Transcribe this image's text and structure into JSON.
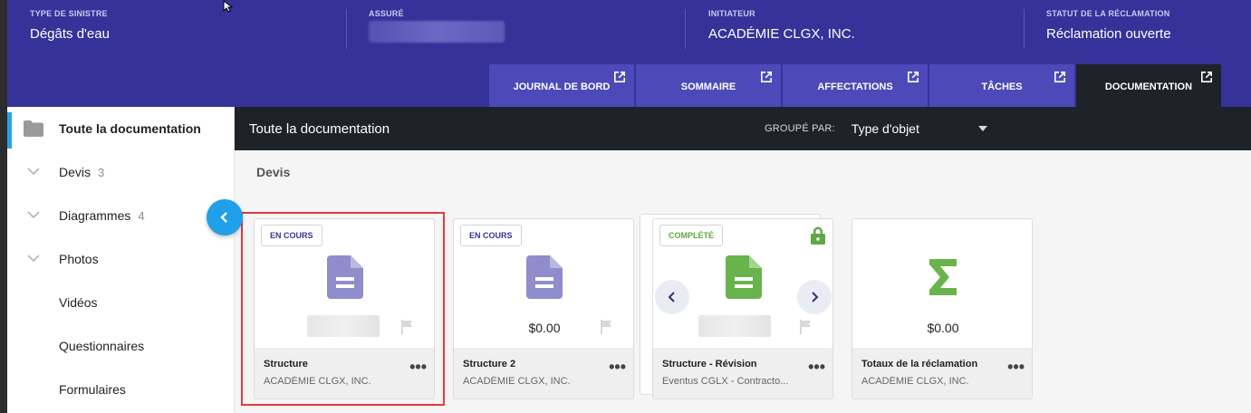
{
  "header": {
    "fields": [
      {
        "label": "TYPE DE SINISTRE",
        "value": "Dégâts d'eau"
      },
      {
        "label": "ASSURÉ",
        "value": ""
      },
      {
        "label": "INITIATEUR",
        "value": "ACADÉMIE CLGX, INC."
      },
      {
        "label": "STATUT DE LA RÉCLAMATION",
        "value": "Réclamation ouverte"
      }
    ],
    "tabs": [
      {
        "label": "JOURNAL DE BORD"
      },
      {
        "label": "SOMMAIRE"
      },
      {
        "label": "AFFECTATIONS"
      },
      {
        "label": "TÂCHES"
      },
      {
        "label": "DOCUMENTATION",
        "active": true
      }
    ]
  },
  "sidebar": {
    "items": [
      {
        "label": "Toute la documentation",
        "count": ""
      },
      {
        "label": "Devis",
        "count": "3"
      },
      {
        "label": "Diagrammes",
        "count": "4"
      },
      {
        "label": "Photos",
        "count": ""
      },
      {
        "label": "Vidéos",
        "count": ""
      },
      {
        "label": "Questionnaires",
        "count": ""
      },
      {
        "label": "Formulaires",
        "count": ""
      }
    ]
  },
  "toolbar": {
    "title": "Toute la documentation",
    "group_label": "GROUPÉ PAR:",
    "group_value": "Type d'objet"
  },
  "section": {
    "title": "Devis"
  },
  "cards": [
    {
      "badge": "EN COURS",
      "amount": "",
      "name": "Structure",
      "sub": "ACADÉMIE CLGX, INC."
    },
    {
      "badge": "EN COURS",
      "amount": "$0.00",
      "name": "Structure 2",
      "sub": "ACADÉMIE CLGX, INC."
    },
    {
      "badge": "COMPLÉTÉ",
      "amount": "",
      "name": "Structure - Révision",
      "sub": "Eventus CGLX - Contracto..."
    },
    {
      "badge": "",
      "amount": "$0.00",
      "name": "Totaux de la réclamation",
      "sub": "ACADÉMIE CLGX, INC."
    }
  ],
  "colors": {
    "header": "#35339a",
    "tab": "#4c4ab8",
    "dark": "#1f2329",
    "accent": "#1fa0e8",
    "doc_purple": "#8f8dcb",
    "doc_green": "#69b34c",
    "highlight": "#e23a44"
  }
}
